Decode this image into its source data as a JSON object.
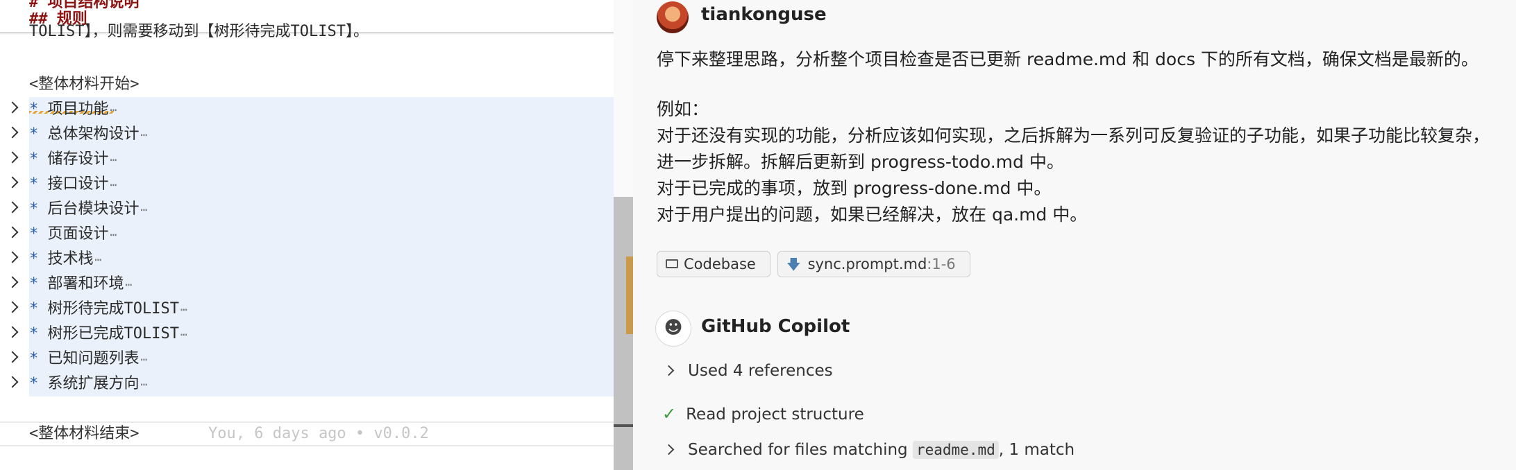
{
  "editor": {
    "header1": "# 项目结构说明",
    "header2": "## 规则",
    "partial_line": "TOLIST】，则需要移动到【树形待完成TOLIST】。",
    "materials_start": "<整体材料开始>",
    "materials_end": "<整体材料结束>",
    "bullet": "*",
    "fold_marker": "⋯",
    "blame": "You, 6 days ago • v0.0.2",
    "sections": [
      "项目功能",
      "总体架构设计",
      "储存设计",
      "接口设计",
      "后台模块设计",
      "页面设计",
      "技术栈",
      "部署和环境",
      "树形待完成TOLIST",
      "树形已完成TOLIST",
      "已知问题列表",
      "系统扩展方向"
    ]
  },
  "chat": {
    "username": "tiankonguse",
    "message": {
      "line1": "停下来整理思路，分析整个项目检查是否已更新 readme.md 和 docs 下的所有文档，确保文档是最新的。",
      "line2": "例如：",
      "line3": "对于还没有实现的功能，分析应该如何实现，之后拆解为一系列可反复验证的子功能，如果子功能比较复杂，",
      "line4": "进一步拆解。拆解后更新到 progress-todo.md 中。",
      "line5": "对于已完成的事项，放到 progress-done.md 中。",
      "line6": "对于用户提出的问题，如果已经解决，放在 qa.md 中。"
    },
    "attachments": {
      "codebase": "Codebase",
      "file_name": "sync.prompt.md",
      "file_range": ":1-6"
    },
    "assistant_name": "GitHub Copilot",
    "steps": {
      "references": "Used 4 references",
      "read_structure": "Read project structure",
      "search_prefix": "Searched for files matching",
      "search_term": "readme.md",
      "search_suffix": ", 1 match"
    }
  }
}
